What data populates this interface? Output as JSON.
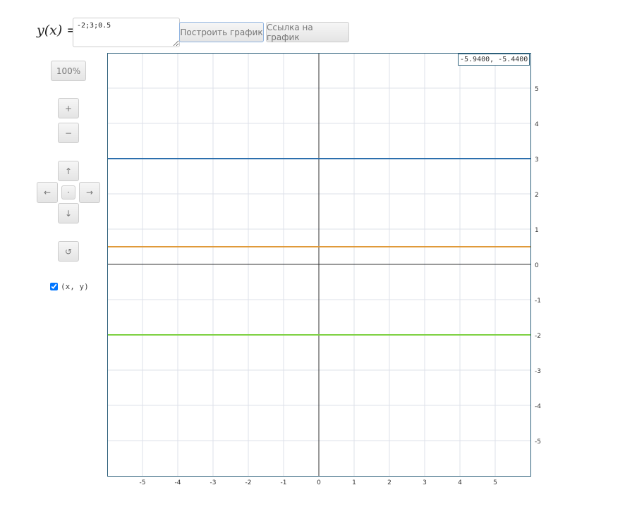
{
  "formula": {
    "label_fn": "y(x)",
    "label_eq": "=",
    "input_value": "-2;3;0.5"
  },
  "buttons": {
    "plot": "Построить график",
    "link": "Ссылка на график",
    "zoom_reset": "100%",
    "zoom_in": "+",
    "zoom_out": "−",
    "up": "↑",
    "down": "↓",
    "left": "←",
    "right": "→",
    "center": "·",
    "reset": "↺"
  },
  "show_coords": {
    "label": "(x, y)",
    "checked": true
  },
  "coord_readout": "-5.9400, -5.4400",
  "chart_data": {
    "type": "line",
    "xlim": [
      -6,
      6
    ],
    "ylim": [
      -6,
      6
    ],
    "grid": true,
    "x_ticks": [
      -5,
      -4,
      -3,
      -2,
      -1,
      0,
      1,
      2,
      3,
      4,
      5
    ],
    "y_ticks": [
      5,
      4,
      3,
      2,
      1,
      0,
      -1,
      -2,
      -3,
      -4,
      -5
    ],
    "series": [
      {
        "expr": "-2",
        "y": -2,
        "color": "#7ed143"
      },
      {
        "expr": "3",
        "y": 3,
        "color": "#2c6fad"
      },
      {
        "expr": "0.5",
        "y": 0.5,
        "color": "#e09a3a"
      }
    ]
  }
}
